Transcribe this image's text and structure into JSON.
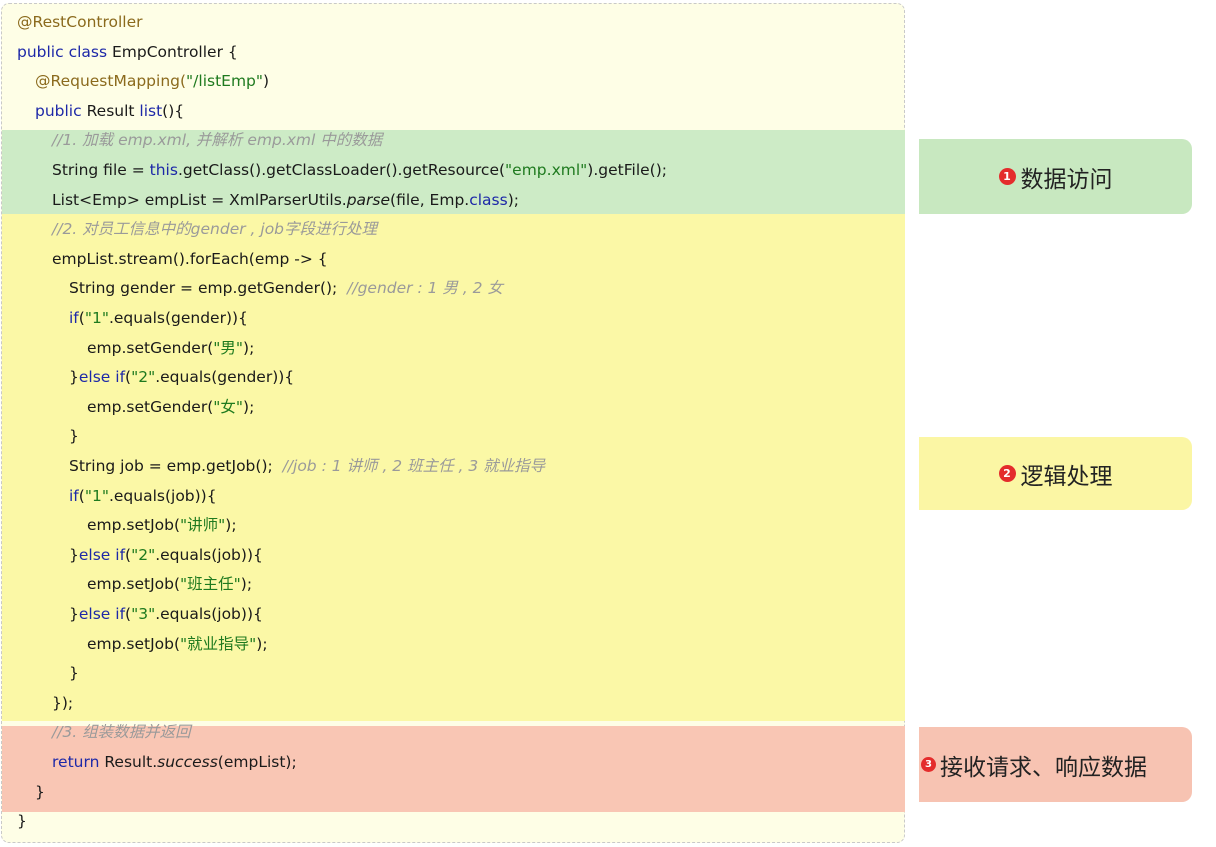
{
  "code": {
    "lines": [
      [
        {
          "t": "@RestController",
          "c": "an"
        }
      ],
      [
        {
          "t": "public class ",
          "c": "kw"
        },
        {
          "t": "EmpController {"
        }
      ],
      [
        {
          "t": "@RequestMapping(",
          "c": "an"
        },
        {
          "t": "\"/listEmp\"",
          "c": "str"
        },
        {
          "t": ")"
        }
      ],
      [
        {
          "t": "public ",
          "c": "kw"
        },
        {
          "t": "Result "
        },
        {
          "t": "list",
          "c": "kw"
        },
        {
          "t": "(){"
        }
      ],
      [
        {
          "t": "//1. 加载 emp.xml, 并解析 emp.xml 中的数据",
          "c": "cm"
        }
      ],
      [
        {
          "t": "String file = "
        },
        {
          "t": "this",
          "c": "kw"
        },
        {
          "t": ".getClass().getClassLoader().getResource("
        },
        {
          "t": "\"emp.xml\"",
          "c": "str"
        },
        {
          "t": ").getFile();"
        }
      ],
      [
        {
          "t": "List<Emp> empList = XmlParserUtils."
        },
        {
          "t": "parse",
          "c": "it"
        },
        {
          "t": "(file, Emp."
        },
        {
          "t": "class",
          "c": "kw"
        },
        {
          "t": ");"
        }
      ],
      [
        {
          "t": "//2. 对员工信息中的gender , job字段进行处理",
          "c": "cm"
        }
      ],
      [
        {
          "t": "empList.stream().forEach(emp -> {"
        }
      ],
      [
        {
          "t": "String gender = emp.getGender();  "
        },
        {
          "t": "//gender : 1 男 , 2 女",
          "c": "cm"
        }
      ],
      [
        {
          "t": "if",
          "c": "kw"
        },
        {
          "t": "("
        },
        {
          "t": "\"1\"",
          "c": "str"
        },
        {
          "t": ".equals(gender)){"
        }
      ],
      [
        {
          "t": "emp.setGender("
        },
        {
          "t": "\"男\"",
          "c": "str"
        },
        {
          "t": ");"
        }
      ],
      [
        {
          "t": "}"
        },
        {
          "t": "else if",
          "c": "kw"
        },
        {
          "t": "("
        },
        {
          "t": "\"2\"",
          "c": "str"
        },
        {
          "t": ".equals(gender)){"
        }
      ],
      [
        {
          "t": "emp.setGender("
        },
        {
          "t": "\"女\"",
          "c": "str"
        },
        {
          "t": ");"
        }
      ],
      [
        {
          "t": "}"
        }
      ],
      [
        {
          "t": "String job = emp.getJob();  "
        },
        {
          "t": "//job : 1 讲师 , 2 班主任 , 3 就业指导",
          "c": "cm"
        }
      ],
      [
        {
          "t": "if",
          "c": "kw"
        },
        {
          "t": "("
        },
        {
          "t": "\"1\"",
          "c": "str"
        },
        {
          "t": ".equals(job)){"
        }
      ],
      [
        {
          "t": "emp.setJob("
        },
        {
          "t": "\"讲师\"",
          "c": "str"
        },
        {
          "t": ");"
        }
      ],
      [
        {
          "t": "}"
        },
        {
          "t": "else if",
          "c": "kw"
        },
        {
          "t": "("
        },
        {
          "t": "\"2\"",
          "c": "str"
        },
        {
          "t": ".equals(job)){"
        }
      ],
      [
        {
          "t": "emp.setJob("
        },
        {
          "t": "\"班主任\"",
          "c": "str"
        },
        {
          "t": ");"
        }
      ],
      [
        {
          "t": "}"
        },
        {
          "t": "else if",
          "c": "kw"
        },
        {
          "t": "("
        },
        {
          "t": "\"3\"",
          "c": "str"
        },
        {
          "t": ".equals(job)){"
        }
      ],
      [
        {
          "t": "emp.setJob("
        },
        {
          "t": "\"就业指导\"",
          "c": "str"
        },
        {
          "t": ");"
        }
      ],
      [
        {
          "t": "}"
        }
      ],
      [
        {
          "t": "});"
        }
      ],
      [
        {
          "t": "//3. 组装数据并返回",
          "c": "cm"
        }
      ],
      [
        {
          "t": "return ",
          "c": "kw"
        },
        {
          "t": "Result."
        },
        {
          "t": "success",
          "c": "it"
        },
        {
          "t": "(empList);"
        }
      ],
      [
        {
          "t": "}"
        }
      ],
      [
        {
          "t": "}"
        }
      ]
    ]
  },
  "labels": {
    "data_access": {
      "badge": "1",
      "text": "数据访问"
    },
    "logic": {
      "badge": "2",
      "text": "逻辑处理"
    },
    "response": {
      "badge": "3",
      "text": "接收请求、响应数据"
    }
  },
  "colors": {
    "keyword": "#1d28a8",
    "annotation": "#8b6a1d",
    "string": "#1f7a1f",
    "comment": "#9a9a9a",
    "band_green": "#cdebc6",
    "band_yellow": "#fbf8a6",
    "band_red": "#f9c6b4",
    "badge": "#e42c2c"
  }
}
